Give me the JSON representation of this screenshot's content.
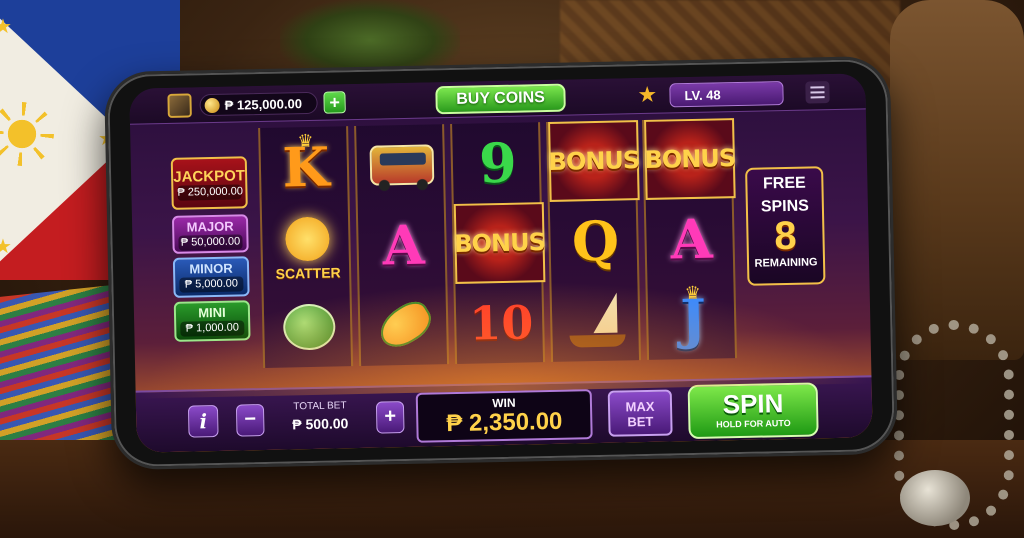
{
  "topbar": {
    "balance": "₱ 125,000.00",
    "add_label": "+",
    "buy_coins_label": "BUY COINS",
    "level_label": "LV. 48"
  },
  "jackpots": [
    {
      "label": "JACKPOT",
      "value": "₱ 250,000.00",
      "color": "#a8121a"
    },
    {
      "label": "MAJOR",
      "value": "₱ 50,000.00",
      "color": "#9a2aa8"
    },
    {
      "label": "MINOR",
      "value": "₱ 5,000.00",
      "color": "#2a5ab8"
    },
    {
      "label": "MINI",
      "value": "₱ 1,000.00",
      "color": "#2a9a2a"
    }
  ],
  "reels": [
    [
      "K",
      "scatter-sun",
      "coconut"
    ],
    [
      "jeepney",
      "A",
      "mango"
    ],
    [
      "9",
      "BONUS",
      "10"
    ],
    [
      "BONUS",
      "Q",
      "sailboat"
    ],
    [
      "BONUS",
      "A",
      "J"
    ]
  ],
  "symbols": {
    "k": "K",
    "a": "A",
    "q": "Q",
    "j": "J",
    "nine": "9",
    "ten": "10",
    "bonus": "BONUS",
    "scatter": "SCATTER"
  },
  "free_spins": {
    "title_line1": "FREE",
    "title_line2": "SPINS",
    "count": "8",
    "remaining_label": "REMAINING"
  },
  "bottombar": {
    "info_label": "i",
    "minus_label": "−",
    "plus_label": "+",
    "total_bet_label": "TOTAL BET",
    "total_bet_value": "₱ 500.00",
    "win_label": "WIN",
    "win_value": "₱ 2,350.00",
    "max_bet_line1": "MAX",
    "max_bet_line2": "BET",
    "spin_label": "SPIN",
    "spin_sub": "HOLD FOR AUTO"
  },
  "colors": {
    "accent_green": "#2a9a1c",
    "accent_gold": "#f2c048",
    "panel_purple": "#3a1652"
  }
}
